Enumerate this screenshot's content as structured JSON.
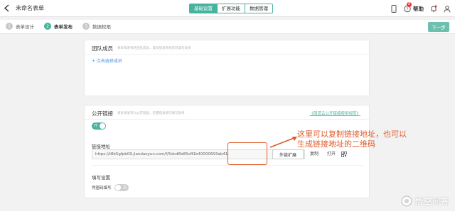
{
  "header": {
    "form_title": "未命名表单",
    "tabs": [
      {
        "label": "基础设置",
        "active": true
      },
      {
        "label": "扩展功能",
        "active": false
      },
      {
        "label": "数据管理",
        "active": false
      }
    ],
    "help_label": "帮助",
    "help_badge": "8",
    "accent_color": "#45b39d"
  },
  "steps": [
    {
      "num": "1",
      "label": "表单设计",
      "active": false
    },
    {
      "num": "2",
      "label": "表单发布",
      "active": true
    },
    {
      "num": "3",
      "label": "数据权限",
      "active": false
    }
  ],
  "next_button": "下一步",
  "team_card": {
    "title": "团队成员",
    "desc": "将表单发布给团队成员，成员登录系统后可填写表单",
    "add_link": "+ 点击选择成员"
  },
  "public_card": {
    "title": "公开链接",
    "desc": "将表单发布为公开链接，无需登录即可填写表单",
    "help_link": "《简道云公开链接使用规范》",
    "toggle_on": "开",
    "url_label": "链接地址",
    "url_value": "https://t8b5gfpb09.jiandaoyun.com/f/5dcd6b85d41b40000693ab41",
    "copy_label": "复制",
    "open_label": "打开",
    "ext_button": "外链扩展",
    "fill_settings_label": "填写设置",
    "password_label": "凭密码填写",
    "toggle_off": "关"
  },
  "annotation": {
    "line1": "这里可以复制链接地址，也可以",
    "line2": "生成链接地址的二维码",
    "color": "#e05a28"
  },
  "watermark": {
    "text": "悟空问答"
  }
}
